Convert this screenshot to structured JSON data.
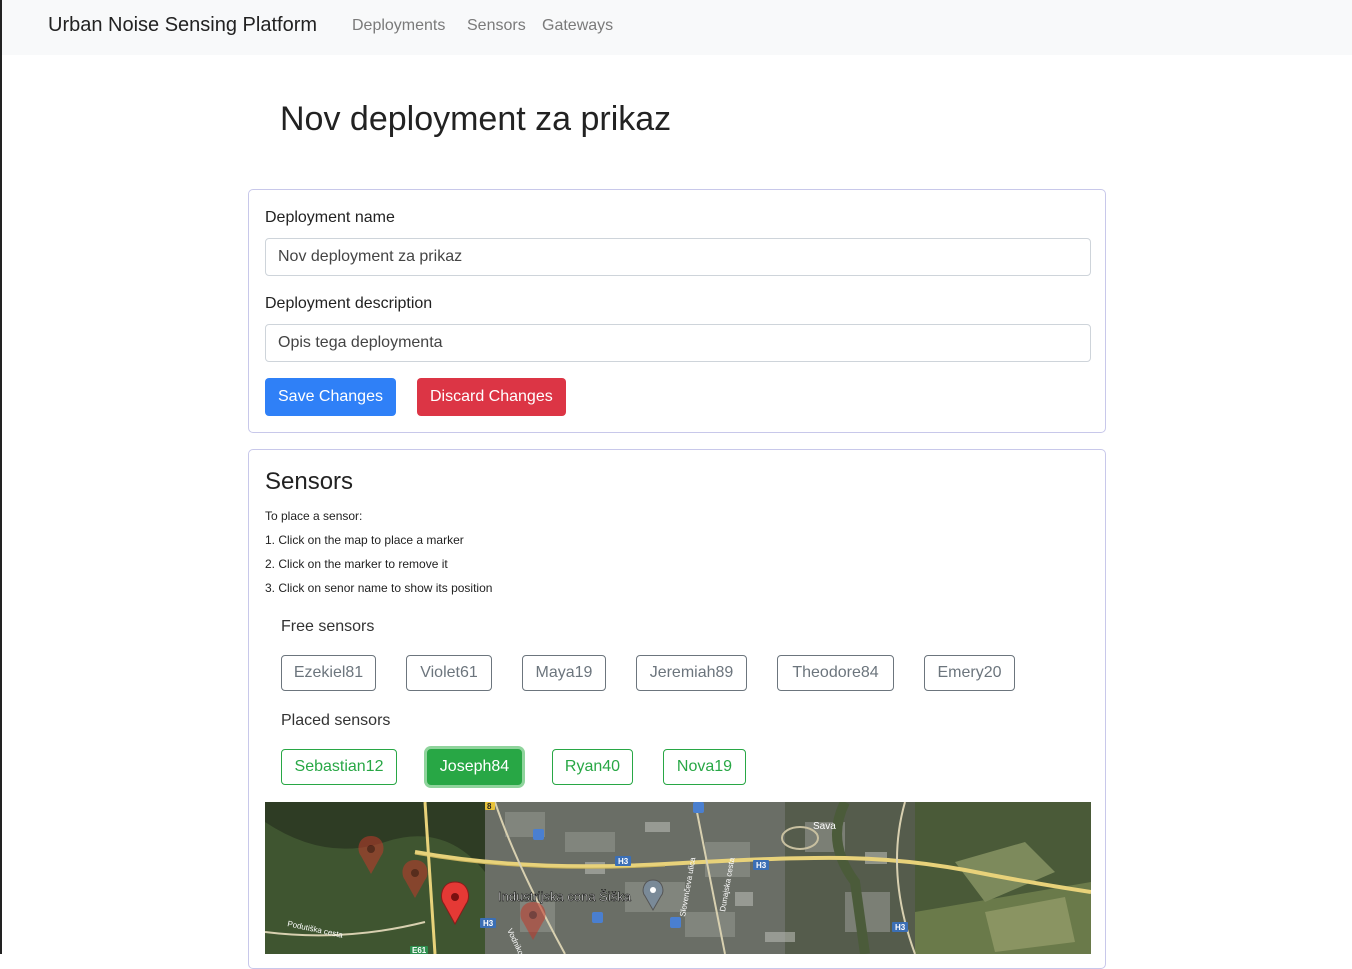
{
  "navbar": {
    "brand": "Urban Noise Sensing Platform",
    "links": [
      "Deployments",
      "Sensors",
      "Gateways"
    ]
  },
  "page": {
    "title": "Nov deployment za prikaz"
  },
  "form": {
    "name_label": "Deployment name",
    "name_value": "Nov deployment za prikaz",
    "description_label": "Deployment description",
    "description_value": "Opis tega deploymenta",
    "save_label": "Save Changes",
    "discard_label": "Discard Changes"
  },
  "sensors": {
    "title": "Sensors",
    "instructions": [
      "To place a sensor:",
      "1. Click on the map to place a marker",
      "2. Click on the marker to remove it",
      "3. Click on senor name to show its position"
    ],
    "free_label": "Free sensors",
    "free": [
      "Ezekiel81",
      "Violet61",
      "Maya19",
      "Jeremiah89",
      "Theodore84",
      "Emery20"
    ],
    "placed_label": "Placed sensors",
    "placed": [
      "Sebastian12",
      "Joseph84",
      "Ryan40",
      "Nova19"
    ],
    "selected": "Joseph84"
  },
  "map": {
    "labels": {
      "industrial_zone": "Industrijska cona Šiška",
      "river": "Sava",
      "highway": "H3",
      "road_e61": "E61",
      "road_8": "8",
      "street_podutiska": "Podutiška cesta",
      "street_vodnikova": "Vodnikova",
      "street_dunajska": "Dunajska cesta",
      "street_slovenceva": "Slovenčeva ulica"
    }
  },
  "colors": {
    "primary": "#2f80f7",
    "danger": "#dc3545",
    "success": "#28a745",
    "secondary": "#6c757d"
  }
}
